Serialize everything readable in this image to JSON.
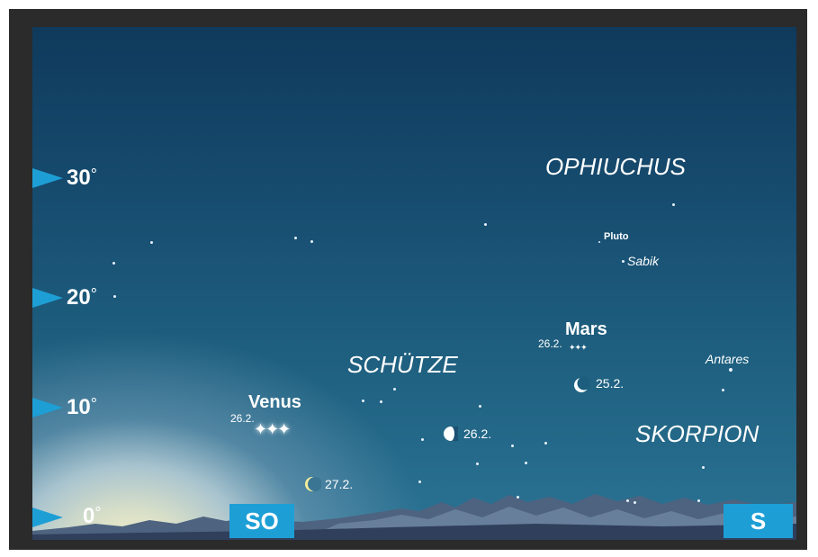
{
  "altitude_labels": [
    {
      "value": "30",
      "symbol": "°"
    },
    {
      "value": "20",
      "symbol": "°"
    },
    {
      "value": "10",
      "symbol": "°"
    },
    {
      "value": "0",
      "symbol": "°"
    }
  ],
  "constellations": {
    "ophiuchus": "OPHIUCHUS",
    "schuetze": "SCHÜTZE",
    "skorpion": "SKORPION"
  },
  "planets": {
    "venus": {
      "name": "Venus",
      "date": "26.2."
    },
    "mars": {
      "name": "Mars",
      "date": "26.2."
    },
    "pluto": "Pluto"
  },
  "stars": {
    "sabik": "Sabik",
    "antares": "Antares"
  },
  "moon_dates": {
    "d25": "25.2.",
    "d26": "26.2.",
    "d27": "27.2."
  },
  "directions": {
    "southeast": "SO",
    "south": "S"
  },
  "colors": {
    "marker": "#1d9fd6",
    "sky_top": "#0f3a5c",
    "frame": "#2b2b2b"
  }
}
